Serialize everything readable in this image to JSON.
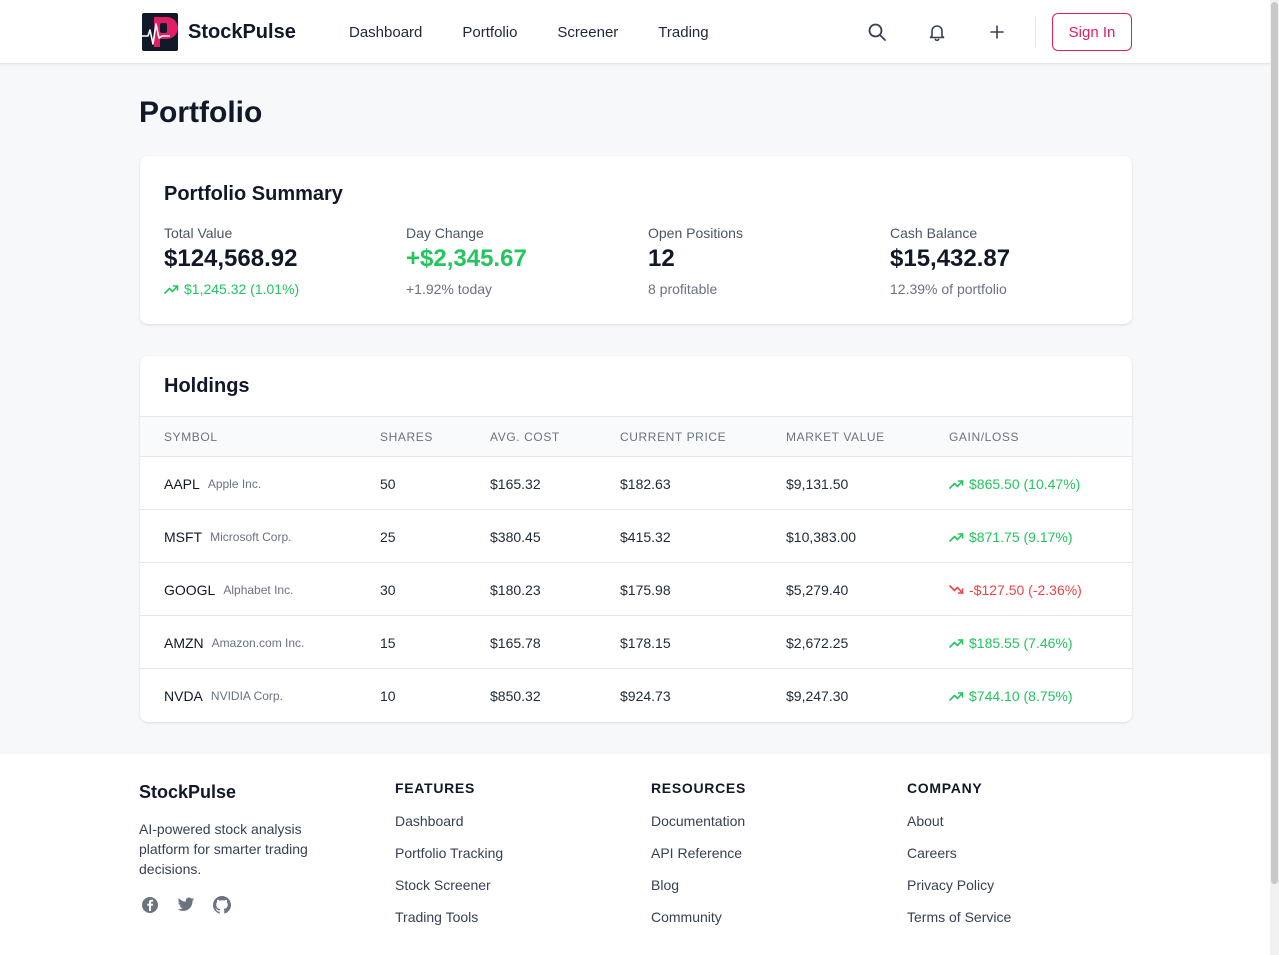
{
  "header": {
    "brand": "StockPulse",
    "nav": [
      "Dashboard",
      "Portfolio",
      "Screener",
      "Trading"
    ],
    "icons": [
      "search-icon",
      "bell-icon",
      "plus-icon"
    ],
    "sign_in": "Sign In",
    "accent": "#e11d64"
  },
  "page": {
    "title": "Portfolio"
  },
  "summary": {
    "title": "Portfolio Summary",
    "stats": [
      {
        "label": "Total Value",
        "value": "$124,568.92",
        "sub": "$1,245.32 (1.01%)"
      },
      {
        "label": "Day Change",
        "value": "+$2,345.67",
        "sub": "+1.92% today"
      },
      {
        "label": "Open Positions",
        "value": "12",
        "sub": "8 profitable"
      },
      {
        "label": "Cash Balance",
        "value": "$15,432.87",
        "sub": "12.39% of portfolio"
      }
    ]
  },
  "holdings": {
    "title": "Holdings",
    "columns": [
      "SYMBOL",
      "SHARES",
      "AVG. COST",
      "CURRENT PRICE",
      "MARKET VALUE",
      "GAIN/LOSS"
    ],
    "rows": [
      {
        "symbol": "AAPL",
        "name": "Apple Inc.",
        "shares": "50",
        "avg_cost": "$165.32",
        "price": "$182.63",
        "market_value": "$9,131.50",
        "gain": "$865.50 (10.47%)",
        "trend": "up"
      },
      {
        "symbol": "MSFT",
        "name": "Microsoft Corp.",
        "shares": "25",
        "avg_cost": "$380.45",
        "price": "$415.32",
        "market_value": "$10,383.00",
        "gain": "$871.75 (9.17%)",
        "trend": "up"
      },
      {
        "symbol": "GOOGL",
        "name": "Alphabet Inc.",
        "shares": "30",
        "avg_cost": "$180.23",
        "price": "$175.98",
        "market_value": "$5,279.40",
        "gain": "-$127.50 (-2.36%)",
        "trend": "down"
      },
      {
        "symbol": "AMZN",
        "name": "Amazon.com Inc.",
        "shares": "15",
        "avg_cost": "$165.78",
        "price": "$178.15",
        "market_value": "$2,672.25",
        "gain": "$185.55 (7.46%)",
        "trend": "up"
      },
      {
        "symbol": "NVDA",
        "name": "NVIDIA Corp.",
        "shares": "10",
        "avg_cost": "$850.32",
        "price": "$924.73",
        "market_value": "$9,247.30",
        "gain": "$744.10 (8.75%)",
        "trend": "up"
      }
    ],
    "colors": {
      "up": "#22c55e",
      "down": "#ef4444"
    }
  },
  "footer": {
    "brand": "StockPulse",
    "description": "AI-powered stock analysis platform for smarter trading decisions.",
    "social": [
      "facebook-icon",
      "twitter-icon",
      "github-icon"
    ],
    "columns": [
      {
        "title": "FEATURES",
        "links": [
          "Dashboard",
          "Portfolio Tracking",
          "Stock Screener",
          "Trading Tools"
        ]
      },
      {
        "title": "RESOURCES",
        "links": [
          "Documentation",
          "API Reference",
          "Blog",
          "Community"
        ]
      },
      {
        "title": "COMPANY",
        "links": [
          "About",
          "Careers",
          "Privacy Policy",
          "Terms of Service"
        ]
      }
    ]
  }
}
